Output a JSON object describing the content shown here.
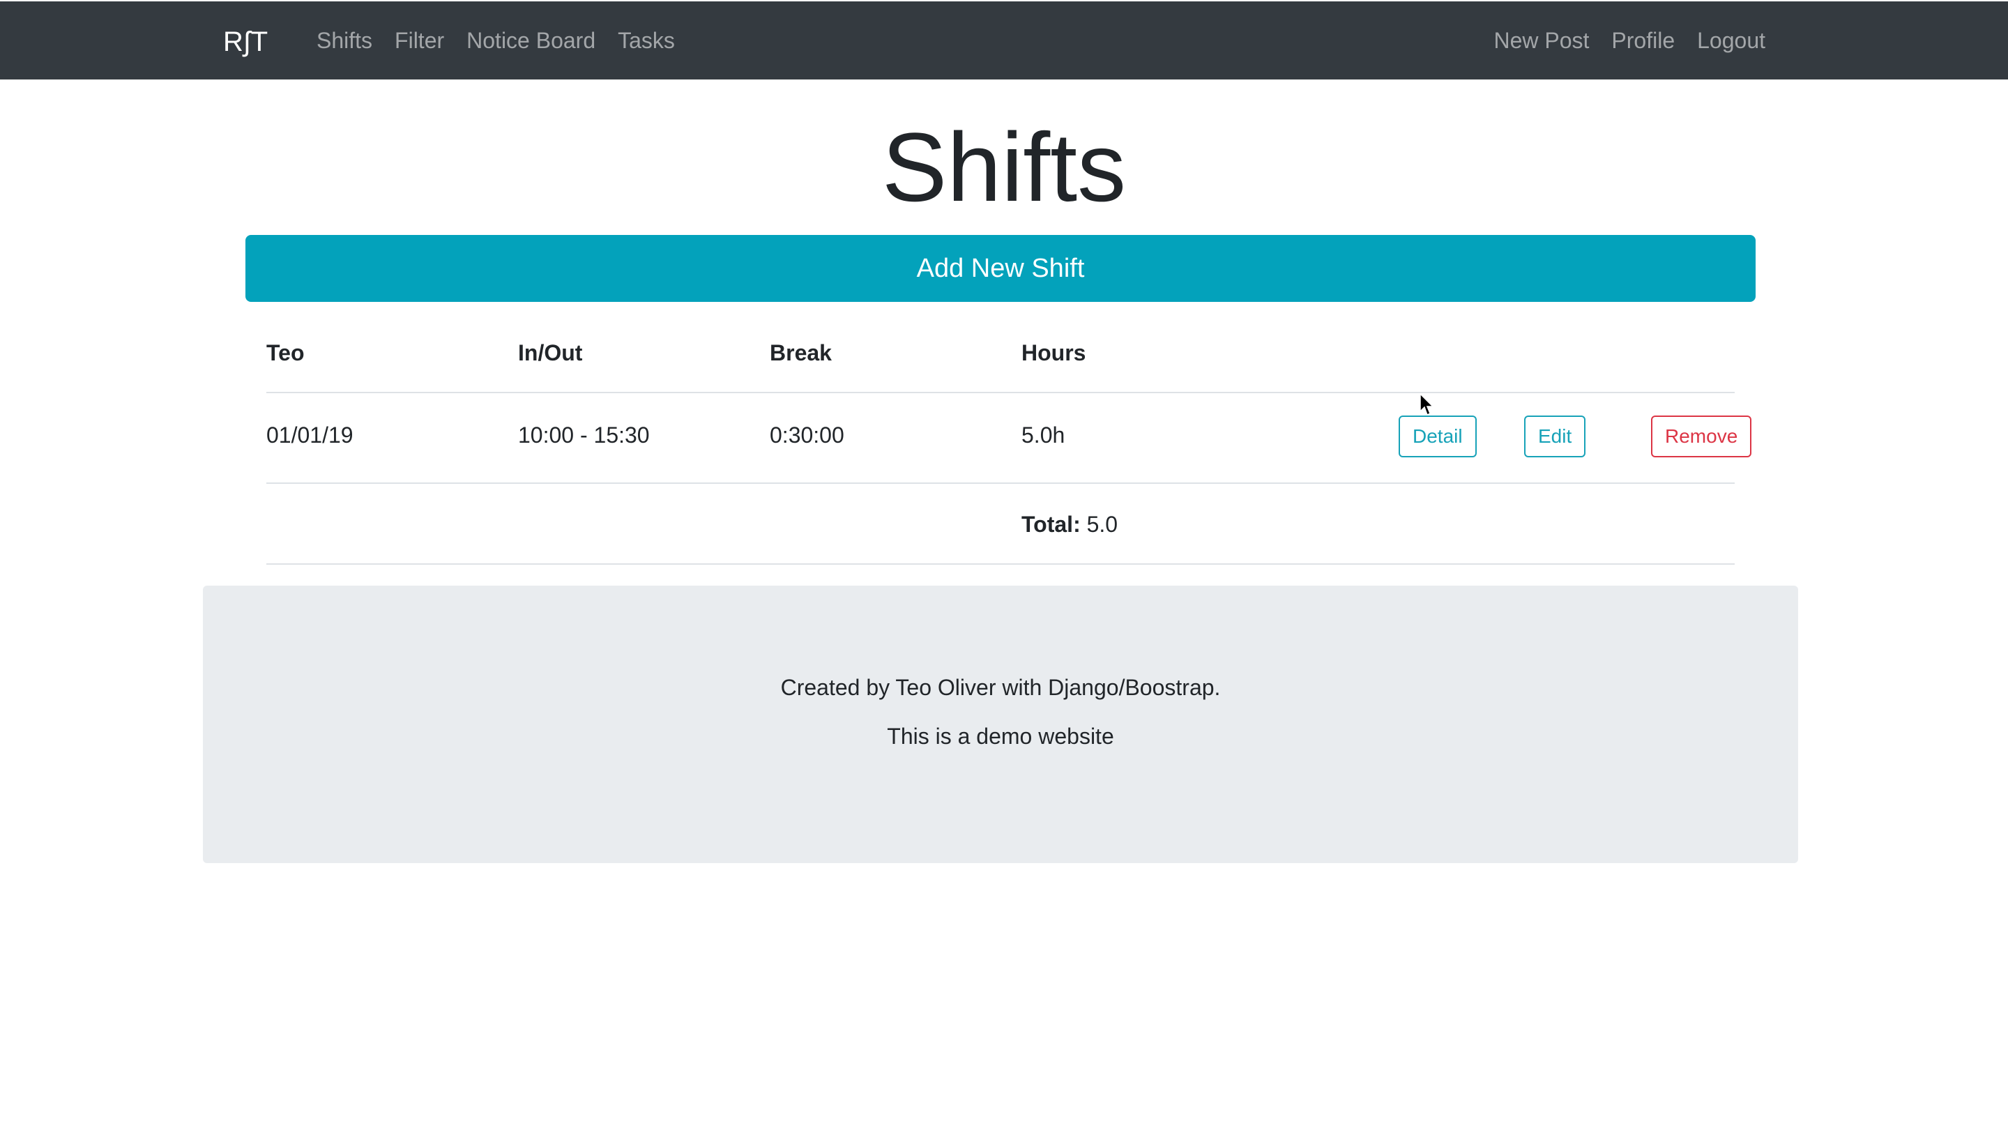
{
  "navbar": {
    "brand": "RʃT",
    "left_links": [
      "Shifts",
      "Filter",
      "Notice Board",
      "Tasks"
    ],
    "right_links": [
      "New Post",
      "Profile",
      "Logout"
    ]
  },
  "page": {
    "title": "Shifts",
    "add_button_label": "Add New Shift"
  },
  "table": {
    "headers": [
      "Teo",
      "In/Out",
      "Break",
      "Hours"
    ],
    "rows": [
      {
        "date": "01/01/19",
        "in_out": "10:00 - 15:30",
        "break": "0:30:00",
        "hours": "5.0h",
        "actions": [
          "Detail",
          "Edit",
          "Remove"
        ]
      }
    ],
    "total_label": "Total:",
    "total_value": "5.0"
  },
  "footer": {
    "line1": "Created by Teo Oliver with Django/Boostrap.",
    "line2": "This is a demo website"
  },
  "colors": {
    "navbar": "#343a40",
    "primary_button": "#03a2bb",
    "info": "#17a2b8",
    "danger": "#dc3545",
    "footer_bg": "#e9ecef"
  }
}
